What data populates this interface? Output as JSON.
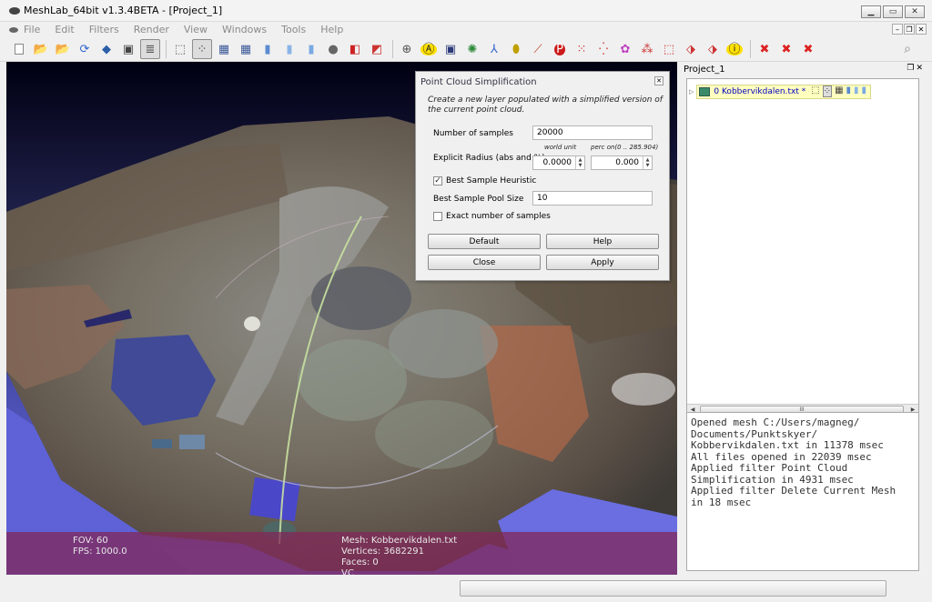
{
  "window": {
    "title": "MeshLab_64bit v1.3.4BETA - [Project_1]"
  },
  "menu": {
    "items": [
      "File",
      "Edit",
      "Filters",
      "Render",
      "View",
      "Windows",
      "Tools",
      "Help"
    ]
  },
  "toolbar": {
    "buttons": [
      {
        "name": "new-project-icon",
        "glyph": "▫",
        "color": "#fff"
      },
      {
        "name": "open-project-icon",
        "glyph": "📂",
        "color": "#e0a020"
      },
      {
        "name": "import-mesh-icon",
        "glyph": "📂",
        "color": "#e0a020"
      },
      {
        "name": "reload-icon",
        "glyph": "⟳",
        "color": "#3366cc"
      },
      {
        "name": "save-icon",
        "glyph": "◆",
        "color": "#2b5ea8"
      },
      {
        "name": "snapshot-icon",
        "glyph": "▣",
        "color": "#444"
      },
      {
        "name": "layers-icon",
        "glyph": "≣",
        "color": "#555",
        "pressed": true
      },
      {
        "name": "bbox-icon",
        "glyph": "⬚",
        "color": "#555"
      },
      {
        "name": "points-icon",
        "glyph": "⁘",
        "color": "#444",
        "pressed": true
      },
      {
        "name": "wireframe-icon",
        "glyph": "▦",
        "color": "#3d5a9a"
      },
      {
        "name": "hidden-lines-icon",
        "glyph": "▦",
        "color": "#3d5a9a"
      },
      {
        "name": "flat-lines-icon",
        "glyph": "▮",
        "color": "#5a8ad0"
      },
      {
        "name": "flat-icon",
        "glyph": "▮",
        "color": "#8ab4e6"
      },
      {
        "name": "smooth-icon",
        "glyph": "▮",
        "color": "#7aa8e2"
      },
      {
        "name": "light-icon",
        "glyph": "●",
        "color": "#666"
      },
      {
        "name": "cull-icon",
        "glyph": "◧",
        "color": "#cc2222"
      },
      {
        "name": "texture-icon",
        "glyph": "◩",
        "color": "#cc3333"
      },
      {
        "name": "trackball-icon",
        "glyph": "⊕",
        "color": "#555"
      },
      {
        "name": "annotation-icon",
        "glyph": "Ⓐ",
        "color": "#222",
        "bg": "#ffe000"
      },
      {
        "name": "measure-icon",
        "glyph": "▣",
        "color": "#2c3a7a"
      },
      {
        "name": "globe-icon",
        "glyph": "✺",
        "color": "#2e8a3a"
      },
      {
        "name": "axes-icon",
        "glyph": "⅄",
        "color": "#3366cc"
      },
      {
        "name": "paint-icon",
        "glyph": "⬮",
        "color": "#c0a000"
      },
      {
        "name": "brush-icon",
        "glyph": "⟋",
        "color": "#c04020"
      },
      {
        "name": "pick-icon",
        "glyph": "P",
        "color": "#fff",
        "bg": "#cc1a1a"
      },
      {
        "name": "select-vertex-icon",
        "glyph": "⁙",
        "color": "#cc3333"
      },
      {
        "name": "select-region-icon",
        "glyph": "⁛",
        "color": "#cc3333"
      },
      {
        "name": "align-icon",
        "glyph": "✿",
        "color": "#c040c0"
      },
      {
        "name": "reference-icon",
        "glyph": "⁂",
        "color": "#cc3333"
      },
      {
        "name": "select-faces-icon",
        "glyph": "⬚",
        "color": "#cc3333"
      },
      {
        "name": "select-connected-icon",
        "glyph": "⬗",
        "color": "#cc3333"
      },
      {
        "name": "delete-selected-icon",
        "glyph": "⬗",
        "color": "#cc3333"
      },
      {
        "name": "info-icon",
        "glyph": "ⓘ",
        "color": "#222",
        "bg": "#ffe000"
      },
      {
        "name": "delete-vertices-icon",
        "glyph": "✖",
        "color": "#dd2222"
      },
      {
        "name": "delete-faces-icon",
        "glyph": "✖",
        "color": "#dd2222"
      },
      {
        "name": "delete-all-icon",
        "glyph": "✖",
        "color": "#dd2222"
      }
    ]
  },
  "viewport": {
    "hud": {
      "fov": "FOV: 60",
      "fps": "FPS:  1000.0",
      "mesh": "Mesh: Kobbervikdalen.txt",
      "vertices": "Vertices: 3682291",
      "faces": "Faces: 0",
      "vc": "VC"
    }
  },
  "dialog": {
    "title": "Point Cloud Simplification",
    "description": "Create a new layer populated with a simplified version of the current point cloud.",
    "num_samples_label": "Number of samples",
    "num_samples_value": "20000",
    "radius_label": "Explicit Radius (abs and %)",
    "world_unit_label": "world unit",
    "perc_label": "perc on(0 .. 285.904)",
    "radius_abs": "0.0000",
    "radius_perc": "0.000",
    "best_heuristic_label": "Best Sample Heuristic",
    "best_heuristic_checked": true,
    "pool_size_label": "Best Sample Pool Size",
    "pool_size_value": "10",
    "exact_label": "Exact number of samples",
    "exact_checked": false,
    "btn_default": "Default",
    "btn_help": "Help",
    "btn_close": "Close",
    "btn_apply": "Apply"
  },
  "layers_panel": {
    "title": "Project_1",
    "layer": {
      "name": "0  Kobbervikdalen.txt *"
    },
    "scroll_thumb": "III"
  },
  "log": {
    "text": "Opened mesh C:/Users/magneg/\nDocuments/Punktskyer/\nKobbervikdalen.txt in 11378 msec\nAll files opened in 22039 msec\nApplied filter Point Cloud\nSimplification in 4931 msec\nApplied filter Delete Current Mesh\nin 18 msec"
  }
}
